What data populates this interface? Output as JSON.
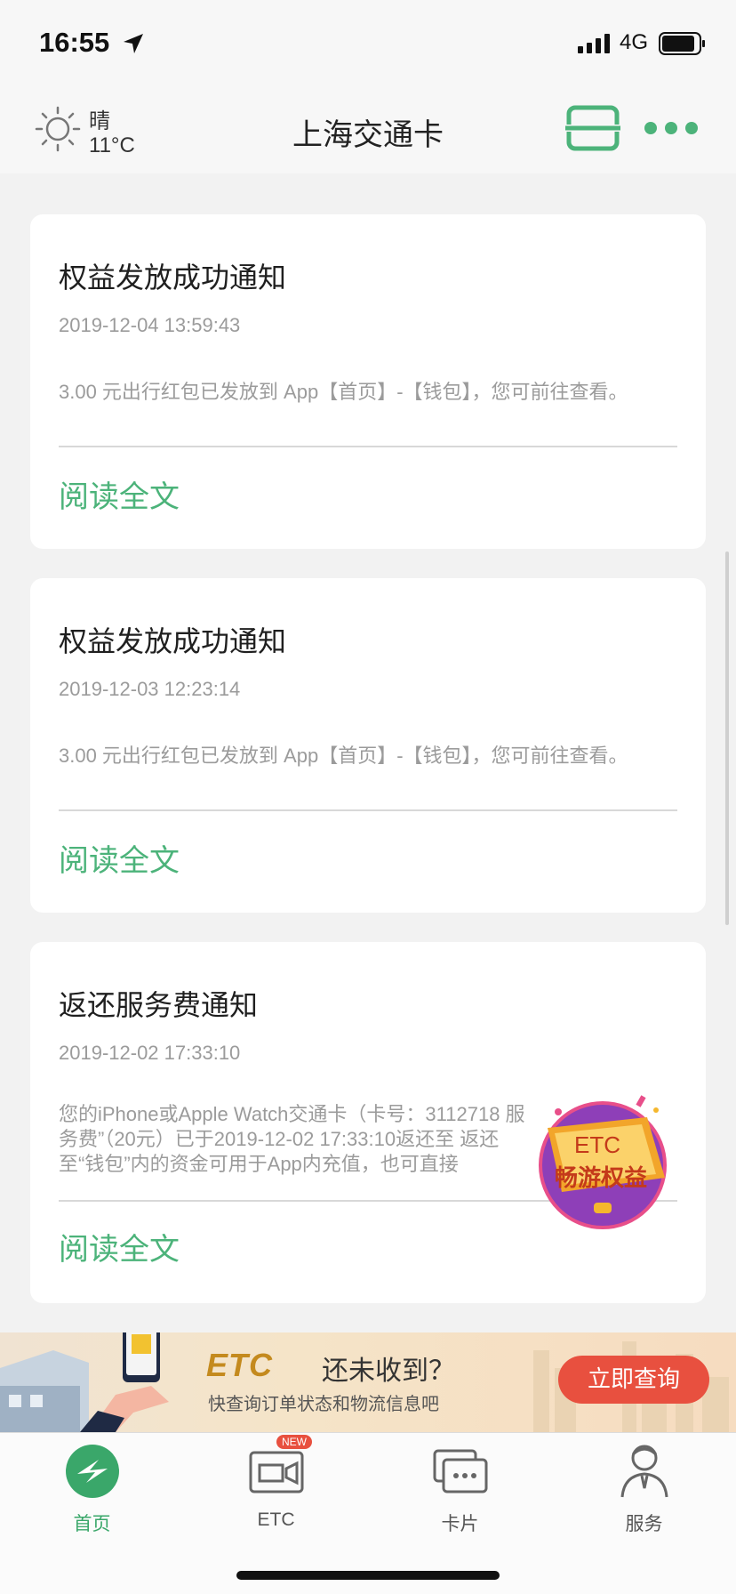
{
  "status_bar": {
    "time": "16:55",
    "network": "4G"
  },
  "nav": {
    "weather_condition": "晴",
    "weather_temp": "11°C",
    "title": "上海交通卡"
  },
  "notifications": [
    {
      "title": "权益发放成功通知",
      "time": "2019-12-04 13:59:43",
      "body": " 3.00  元出行红包已发放到 App【首页】-【钱包】，您可前往查看。",
      "link": "阅读全文"
    },
    {
      "title": "权益发放成功通知",
      "time": "2019-12-03 12:23:14",
      "body": " 3.00  元出行红包已发放到 App【首页】-【钱包】，您可前往查看。",
      "link": "阅读全文"
    },
    {
      "title": "返还服务费通知",
      "time": "2019-12-02 17:33:10",
      "body": "您的iPhone或Apple Watch交通卡（卡号：3112718 服务费”（20元）已于2019-12-02 17:33:10返还至 返还至“钱包”内的资金可用于App内充值，也可直接",
      "link": "阅读全文"
    }
  ],
  "etc_float": {
    "line1": "ETC",
    "line2": "畅游权益"
  },
  "banner": {
    "brand": "ETC",
    "headline": "还未收到？",
    "subline": "快查询订单状态和物流信息吧",
    "button": "立即查询"
  },
  "tabs": [
    {
      "label": "首页",
      "icon": "home-icon",
      "active": true
    },
    {
      "label": "ETC",
      "icon": "etc-icon",
      "badge": "NEW"
    },
    {
      "label": "卡片",
      "icon": "cards-icon"
    },
    {
      "label": "服务",
      "icon": "service-icon"
    }
  ],
  "colors": {
    "accent": "#4cb37a",
    "banner_button": "#e8503f"
  }
}
